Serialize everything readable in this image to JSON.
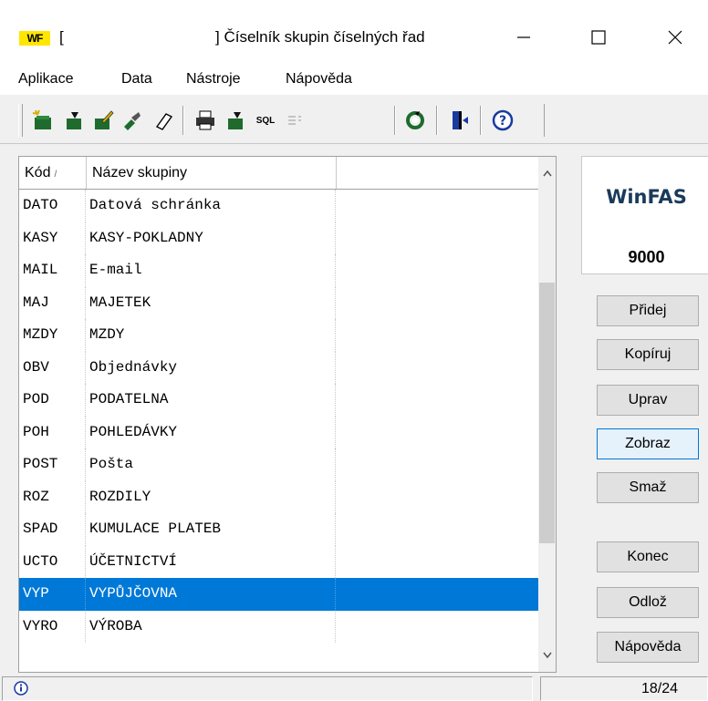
{
  "window": {
    "logo": "WF",
    "title_prefix": "[",
    "title": "] Číselník skupin číselných řad"
  },
  "menu": [
    "Aplikace",
    "Data",
    "Nástroje",
    "Nápověda"
  ],
  "toolbar": {
    "buttons": [
      "new-record-icon",
      "edit-record-icon",
      "edit-pencil-icon",
      "copy-record-icon",
      "eraser-icon",
      "print-icon",
      "export-icon",
      "sql-icon",
      "filter-icon",
      "refresh-icon",
      "exit-door-icon",
      "help-icon"
    ],
    "sql_label": "SQL"
  },
  "grid": {
    "columns": [
      "Kód",
      "Název skupiny"
    ],
    "sort_indicator": "/",
    "rows": [
      {
        "code": "DATO",
        "name": "Datová schránka"
      },
      {
        "code": "KASY",
        "name": "KASY-POKLADNY"
      },
      {
        "code": "MAIL",
        "name": "E-mail"
      },
      {
        "code": "MAJ",
        "name": "MAJETEK"
      },
      {
        "code": "MZDY",
        "name": "MZDY"
      },
      {
        "code": "OBV",
        "name": "Objednávky"
      },
      {
        "code": "POD",
        "name": "PODATELNA"
      },
      {
        "code": "POH",
        "name": "POHLEDÁVKY"
      },
      {
        "code": "POST",
        "name": "Pošta"
      },
      {
        "code": "ROZ",
        "name": "ROZDILY"
      },
      {
        "code": "SPAD",
        "name": "KUMULACE PLATEB"
      },
      {
        "code": "UCTO",
        "name": "ÚČETNICTVÍ"
      },
      {
        "code": "VYP",
        "name": "VYPŮJČOVNA"
      },
      {
        "code": "VYRO",
        "name": "VÝROBA"
      }
    ],
    "selected_index": 12
  },
  "side": {
    "logo": "WinFAS",
    "number": "9000",
    "buttons": {
      "add": "Přidej",
      "copy": "Kopíruj",
      "edit": "Uprav",
      "view": "Zobraz",
      "delete": "Smaž",
      "end": "Konec",
      "defer": "Odlož",
      "help": "Nápověda"
    }
  },
  "status": {
    "position": "18/24"
  },
  "colors": {
    "selection": "#0078d7",
    "focus_border": "#0078d7",
    "logo_yellow": "#ffe600"
  }
}
